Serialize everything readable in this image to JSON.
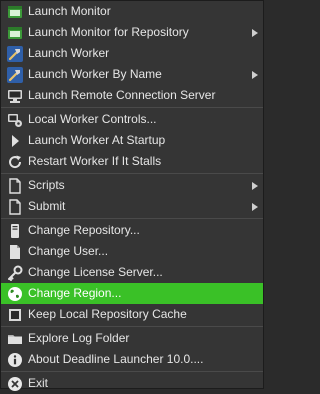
{
  "menu": {
    "items": [
      {
        "id": "launch-monitor",
        "label": "Launch Monitor",
        "icon": "monitor-app-icon",
        "submenu": false
      },
      {
        "id": "launch-monitor-for-repository",
        "label": "Launch Monitor for Repository",
        "icon": "monitor-app-icon",
        "submenu": true
      },
      {
        "id": "launch-worker",
        "label": "Launch Worker",
        "icon": "worker-hammer-icon",
        "submenu": false
      },
      {
        "id": "launch-worker-by-name",
        "label": "Launch Worker By Name",
        "icon": "worker-hammer-icon",
        "submenu": true
      },
      {
        "id": "launch-remote-connection-server",
        "label": "Launch Remote Connection Server",
        "icon": "computer-icon",
        "submenu": false
      },
      {
        "id": "local-worker-controls",
        "label": "Local Worker Controls...",
        "icon": "worker-controls-icon",
        "submenu": false
      },
      {
        "id": "launch-worker-at-startup",
        "label": "Launch Worker At Startup",
        "icon": "play-arrow-icon",
        "submenu": false
      },
      {
        "id": "restart-worker-if-it-stalls",
        "label": "Restart Worker If It Stalls",
        "icon": "refresh-icon",
        "submenu": false
      },
      {
        "id": "scripts",
        "label": "Scripts",
        "icon": "document-icon",
        "submenu": true
      },
      {
        "id": "submit",
        "label": "Submit",
        "icon": "document-icon",
        "submenu": true
      },
      {
        "id": "change-repository",
        "label": "Change Repository...",
        "icon": "server-tower-icon",
        "submenu": false
      },
      {
        "id": "change-user",
        "label": "Change User...",
        "icon": "user-icon",
        "submenu": false
      },
      {
        "id": "change-license-server",
        "label": "Change License Server...",
        "icon": "key-icon",
        "submenu": false
      },
      {
        "id": "change-region",
        "label": "Change Region...",
        "icon": "globe-icon",
        "submenu": false,
        "highlighted": true
      },
      {
        "id": "keep-local-repository-cache",
        "label": "Keep Local Repository Cache",
        "icon": "checkbox-icon",
        "submenu": false
      },
      {
        "id": "explore-log-folder",
        "label": "Explore Log Folder",
        "icon": "folder-icon",
        "submenu": false
      },
      {
        "id": "about-deadline-launcher",
        "label": "About Deadline Launcher 10.0....",
        "icon": "info-icon",
        "submenu": false
      },
      {
        "id": "exit",
        "label": "Exit",
        "icon": "power-icon",
        "submenu": false
      }
    ]
  },
  "colors": {
    "menu_background": "#353535",
    "highlight": "#3ac127",
    "text": "#e6e6e6",
    "separator": "#4a4a4a"
  }
}
